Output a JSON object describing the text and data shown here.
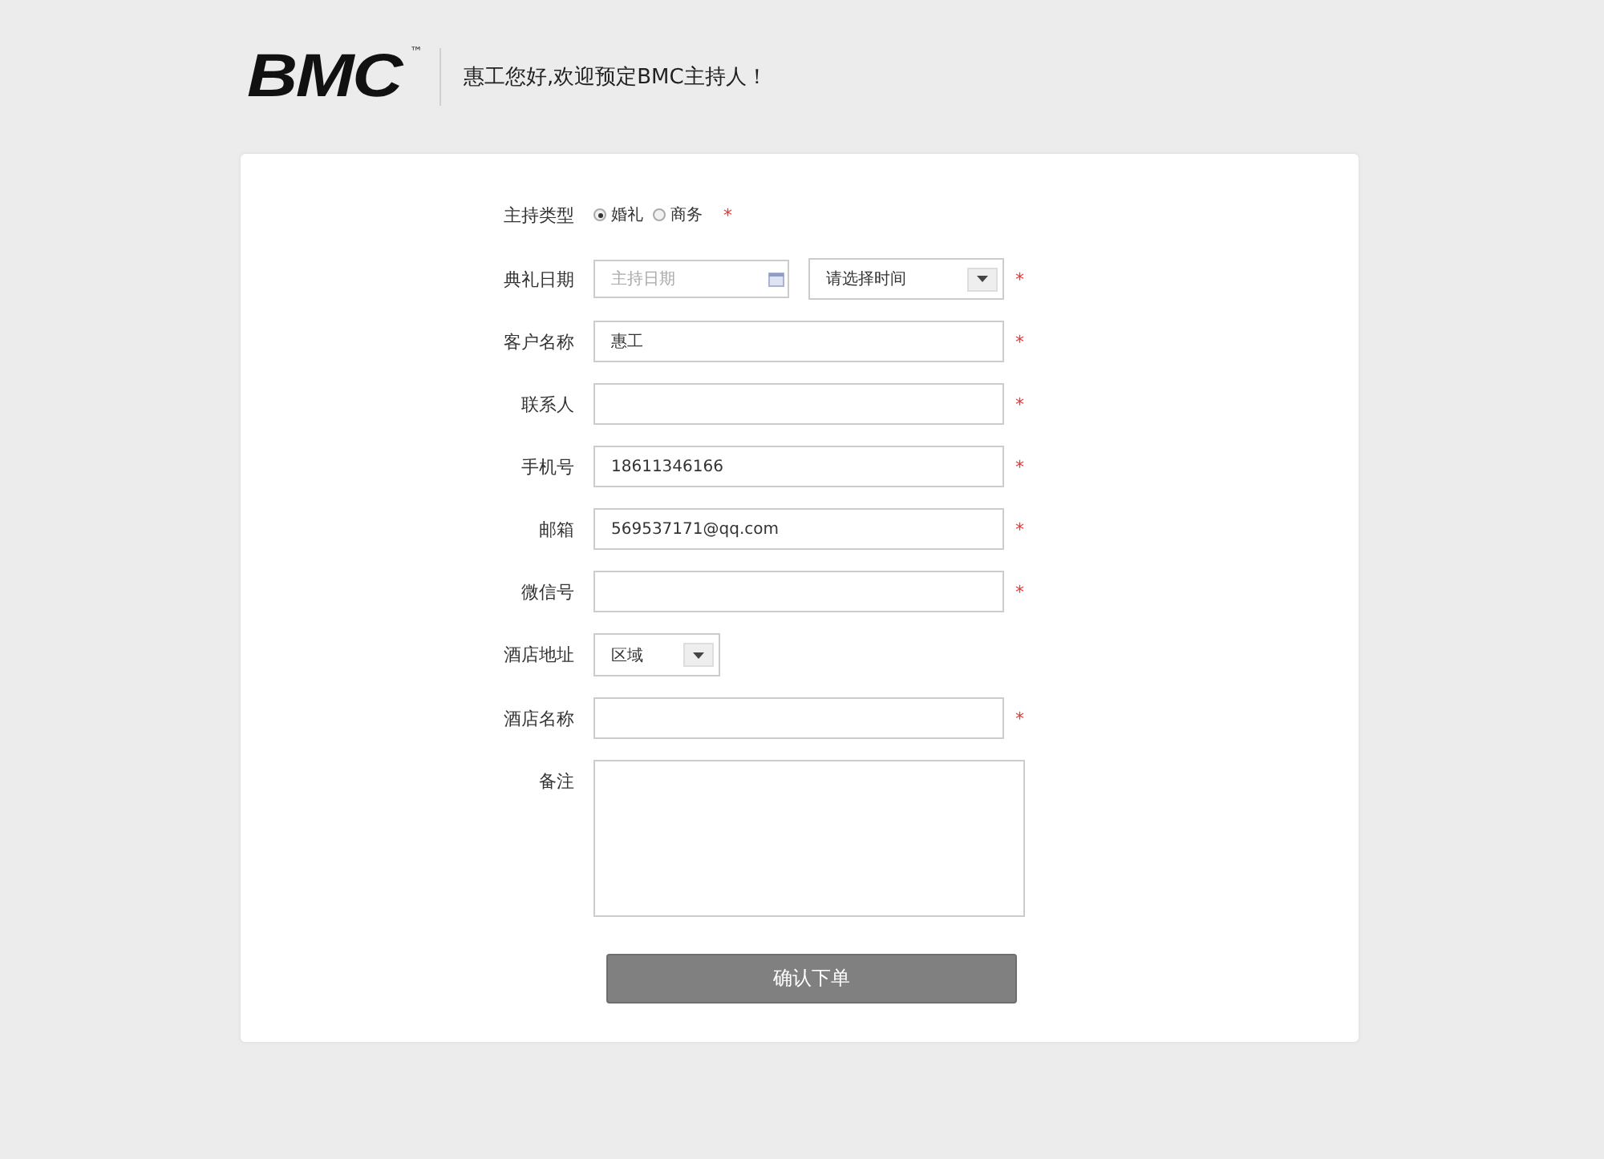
{
  "header": {
    "logo": "BMC",
    "trademark": "™",
    "greeting": "惠工您好,欢迎预定BMC主持人！"
  },
  "form": {
    "rows": [
      {
        "kind": "radio",
        "label": "主持类型",
        "options": [
          {
            "label": "婚礼",
            "selected": true
          },
          {
            "label": "商务",
            "selected": false
          }
        ],
        "required_mark": "*"
      },
      {
        "kind": "datetime",
        "label": "典礼日期",
        "placeholder": "主持日期",
        "select": "请选择时间",
        "required_mark": "*"
      },
      {
        "kind": "text",
        "label": "客户名称",
        "value": "惠工",
        "required_mark": "*"
      },
      {
        "kind": "text",
        "label": "联系人",
        "required_mark": "*"
      },
      {
        "kind": "text",
        "label": "手机号",
        "value": "18611346166",
        "required_mark": "*"
      },
      {
        "kind": "text",
        "label": "邮箱",
        "value": "569537171@qq.com",
        "required_mark": "*"
      },
      {
        "kind": "text",
        "label": "微信号",
        "required_mark": "*"
      },
      {
        "kind": "select",
        "label": "酒店地址",
        "select": "区域"
      },
      {
        "kind": "text",
        "label": "酒店名称",
        "required_mark": "*"
      },
      {
        "kind": "textarea",
        "label": "备注"
      }
    ],
    "submit": "确认下单"
  }
}
